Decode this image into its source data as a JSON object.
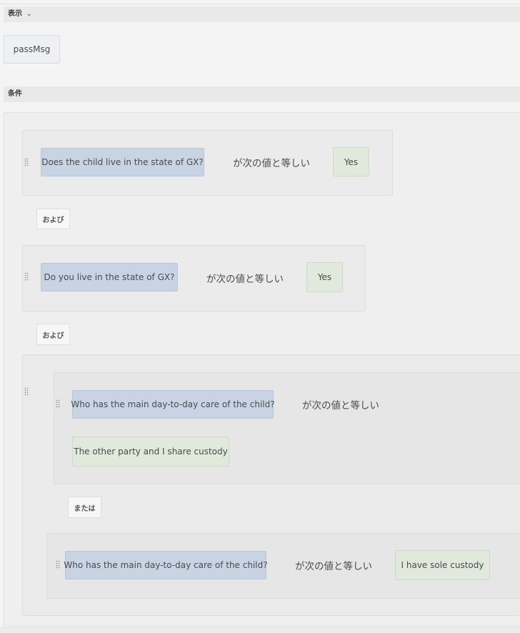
{
  "display_section": {
    "label": "表示",
    "chevron_icon": "chevron-down-icon"
  },
  "target_field": {
    "label": "passMsg"
  },
  "conditions_section": {
    "label": "条件"
  },
  "operator_label": "が次の値と等しい",
  "rules": [
    {
      "field": "Does the child live in the state of GX?",
      "operator": "が次の値と等しい",
      "value": "Yes"
    },
    {
      "field": "Do you live in the state of GX?",
      "operator": "が次の値と等しい",
      "value": "Yes"
    }
  ],
  "connectors": {
    "and_1": "および",
    "and_2": "および",
    "or_1": "または"
  },
  "group": {
    "rules": [
      {
        "field": "Who has the main day-to-day care of the child?",
        "operator": "が次の値と等しい",
        "value": "The other party and I share custody"
      },
      {
        "field": "Who has the main day-to-day care of the child?",
        "operator": "が次の値と等しい",
        "value": "I have sole custody"
      }
    ]
  },
  "icons": {
    "drag_handle": "drag-handle-icon"
  }
}
